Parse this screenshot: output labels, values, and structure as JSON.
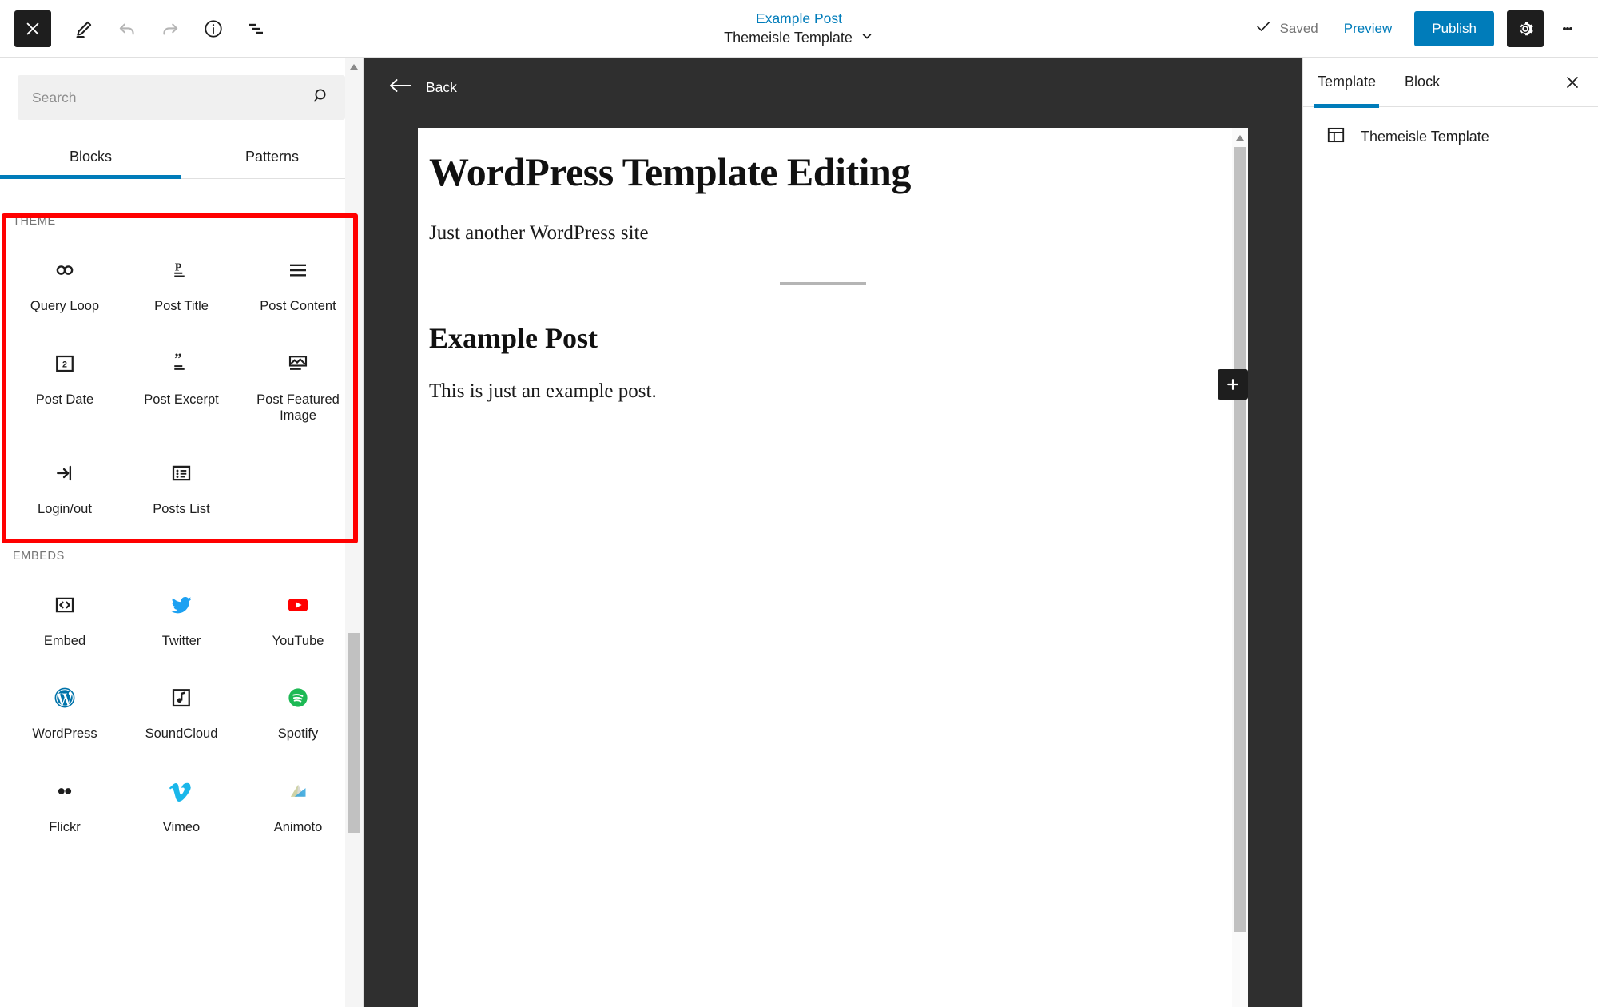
{
  "topbar": {
    "close_icon": "close-icon",
    "edit_icon": "pencil-icon",
    "undo_icon": "undo-icon",
    "redo_icon": "redo-icon",
    "info_icon": "info-icon",
    "list_view_icon": "list-view-icon",
    "post_link": "Example Post",
    "template_name": "Themeisle Template",
    "template_chevron": "chevron-down-icon",
    "saved_label": "Saved",
    "saved_check": "checkmark-icon",
    "preview_label": "Preview",
    "publish_label": "Publish",
    "settings_icon": "gear-icon",
    "more_icon": "kebab-menu-icon"
  },
  "inserter": {
    "search": {
      "placeholder": "Search",
      "value": "",
      "icon": "search-icon"
    },
    "tabs": [
      {
        "label": "Blocks",
        "active": true
      },
      {
        "label": "Patterns",
        "active": false
      }
    ],
    "sections": [
      {
        "title": "THEME",
        "highlighted": true,
        "blocks": [
          {
            "label": "Query Loop",
            "icon": "loop-icon"
          },
          {
            "label": "Post Title",
            "icon": "post-title-icon"
          },
          {
            "label": "Post Content",
            "icon": "post-content-icon"
          },
          {
            "label": "Post Date",
            "icon": "calendar-icon"
          },
          {
            "label": "Post Excerpt",
            "icon": "quote-excerpt-icon"
          },
          {
            "label": "Post Featured Image",
            "icon": "featured-image-icon"
          },
          {
            "label": "Login/out",
            "icon": "login-icon"
          },
          {
            "label": "Posts List",
            "icon": "posts-list-icon"
          }
        ]
      },
      {
        "title": "EMBEDS",
        "highlighted": false,
        "blocks": [
          {
            "label": "Embed",
            "icon": "embed-code-icon"
          },
          {
            "label": "Twitter",
            "icon": "twitter-icon"
          },
          {
            "label": "YouTube",
            "icon": "youtube-icon"
          },
          {
            "label": "WordPress",
            "icon": "wordpress-icon"
          },
          {
            "label": "SoundCloud",
            "icon": "soundcloud-icon"
          },
          {
            "label": "Spotify",
            "icon": "spotify-icon"
          },
          {
            "label": "Flickr",
            "icon": "flickr-icon"
          },
          {
            "label": "Vimeo",
            "icon": "vimeo-icon"
          },
          {
            "label": "Animoto",
            "icon": "animoto-icon"
          }
        ]
      }
    ]
  },
  "canvas": {
    "back_label": "Back",
    "back_icon": "arrow-left-icon",
    "site_title": "WordPress Template Editing",
    "tagline": "Just another WordPress site",
    "post_title": "Example Post",
    "post_body": "This is just an example post.",
    "add_block_icon": "plus-icon"
  },
  "right_sidebar": {
    "tabs": [
      {
        "label": "Template",
        "active": true
      },
      {
        "label": "Block",
        "active": false
      }
    ],
    "close_icon": "close-icon",
    "item": {
      "label": "Themeisle Template",
      "icon": "template-layout-icon"
    }
  },
  "colors": {
    "accent_blue": "#007cba",
    "highlight_red": "#ff0000",
    "dark_canvas": "#2f2f2f",
    "dark_button": "#1e1e1e",
    "twitter": "#1da1f2",
    "youtube": "#ff0000",
    "wordpress": "#0073aa",
    "spotify": "#1db954",
    "vimeo": "#1ab7ea"
  }
}
